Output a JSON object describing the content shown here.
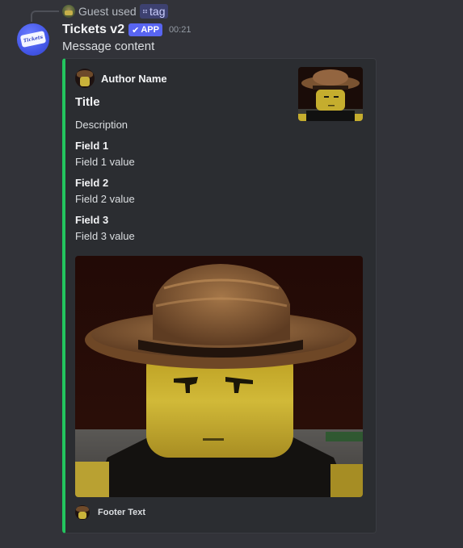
{
  "interaction": {
    "user": "Guest",
    "verb": "used",
    "command": "tag"
  },
  "message": {
    "author": "Tickets v2",
    "badge": "APP",
    "timestamp": "00:21",
    "content": "Message content"
  },
  "embed": {
    "accent_color": "#23c55e",
    "author_name": "Author Name",
    "title": "Title",
    "description": "Description",
    "fields": [
      {
        "name": "Field 1",
        "value": "Field 1 value"
      },
      {
        "name": "Field 2",
        "value": "Field 2 value"
      },
      {
        "name": "Field 3",
        "value": "Field 3 value"
      }
    ],
    "footer_text": "Footer Text"
  },
  "icons": {
    "bot_avatar": "ticket-avatar-icon",
    "app_badge_check": "checkmark-icon",
    "command_icon": "slash-command-icon"
  },
  "colors": {
    "background": "#323339",
    "embed_background": "#2b2d31",
    "app_badge": "#5865f2"
  }
}
